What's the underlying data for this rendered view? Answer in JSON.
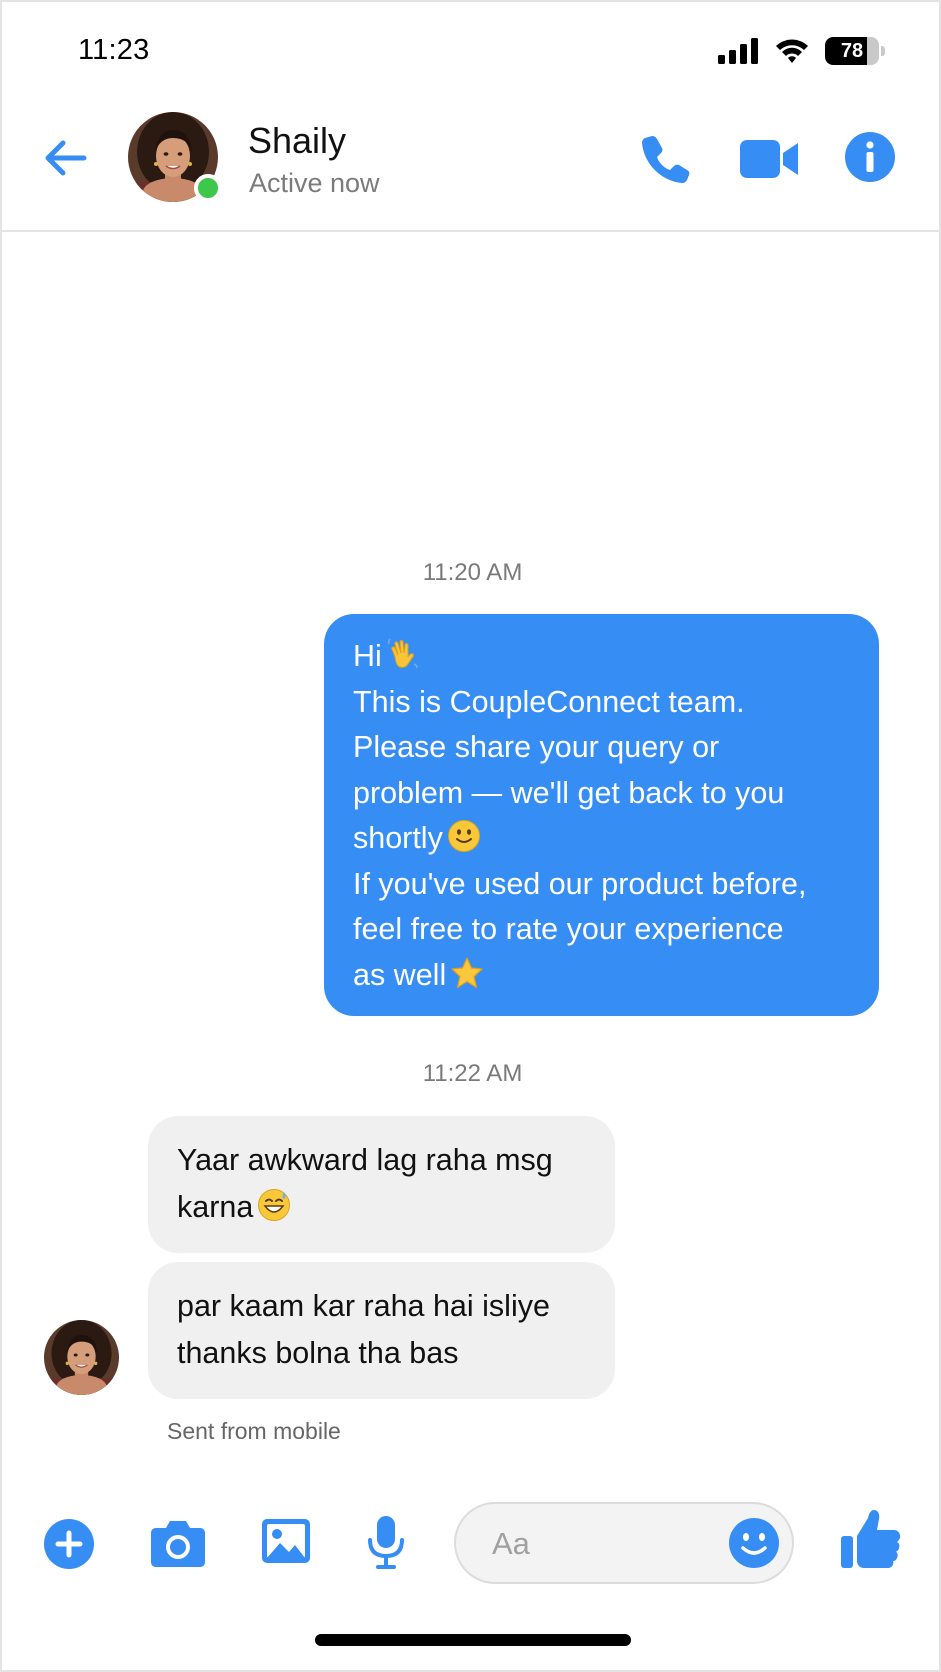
{
  "status_bar": {
    "time": "11:23",
    "battery_level": "78",
    "battery_fraction": 0.78
  },
  "header": {
    "contact_name": "Shaily",
    "contact_status": "Active now",
    "online": true,
    "icons": [
      "back-arrow-icon",
      "phone-icon",
      "video-camera-icon",
      "info-icon"
    ]
  },
  "conversation": {
    "timestamps": [
      "11:20 AM",
      "11:22 AM"
    ],
    "outgoing": {
      "lines": [
        "Hi",
        "This is CoupleConnect team.",
        "Please share your query or",
        "problem — we'll get back to you",
        "shortly",
        "If you've used our product before,",
        "feel free to rate your experience",
        "as well"
      ],
      "emojis": [
        "waving-hand",
        "smiling-face",
        "star"
      ]
    },
    "incoming": [
      {
        "lines": [
          "Yaar awkward lag raha msg",
          "karna"
        ],
        "emoji": "grinning-sweat-face"
      },
      {
        "lines": [
          "par kaam kar raha hai isliye",
          "thanks bolna tha bas"
        ]
      }
    ],
    "sent_note": "Sent from mobile"
  },
  "composer": {
    "placeholder": "Aa",
    "icons": [
      "plus-icon",
      "camera-icon",
      "gallery-icon",
      "mic-icon",
      "emoji-icon",
      "thumbs-up-icon"
    ]
  },
  "colors": {
    "accent": "#368ef4",
    "online": "#3ec74a",
    "incoming_bubble": "#f0f0f0"
  }
}
